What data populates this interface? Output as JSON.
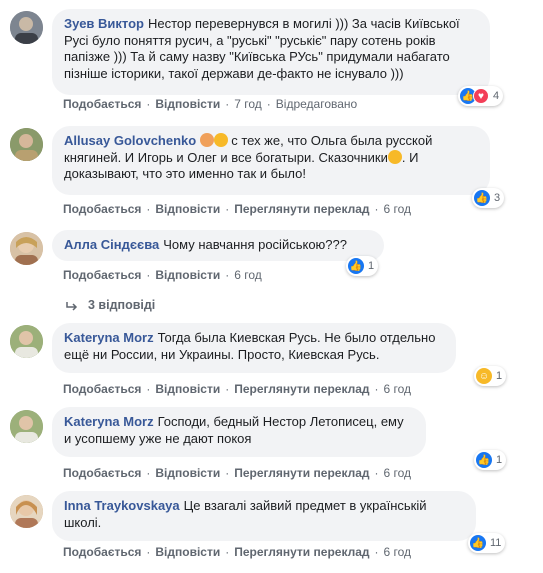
{
  "colors": {
    "author": "#385898",
    "bubble": "#f2f3f5",
    "meta": "#606770",
    "like": "#1877f2",
    "love": "#f33e58",
    "haha": "#f7b928"
  },
  "actions": {
    "like": "Подобається",
    "reply": "Відповісти",
    "translate": "Переглянути переклад",
    "edited": "Відредаговано"
  },
  "comments": [
    {
      "author": "Зуев Виктор",
      "text": "Нестор перевернувся в могилі ))) За часів Київської Русі було поняття русич, а \"руські\" \"руськіє\" пару сотень років папізже ))) Та й саму назву \"Київська РУсь\" придумали набагато пізніше історики, такої держави де-факто не існувало )))",
      "time": "7 год",
      "reactions": "4",
      "reaction_icons": [
        "like-icon",
        "love-icon"
      ]
    },
    {
      "author": "Allusay Golovchenko",
      "text_before": "с тех же, что Ольга была русской княгиней. И Игорь и Олег и все богатыри. Сказочники",
      "text_after": ". И доказывают, что это именно так и было!",
      "time": "6 год",
      "reactions": "3",
      "reaction_icons": [
        "like-icon"
      ]
    },
    {
      "author": "Алла Сіндєєва",
      "text": "Чому навчання російською???",
      "time": "6 год",
      "reactions": "1",
      "reaction_icons": [
        "like-icon"
      ]
    },
    {
      "author": "Kateryna Morz",
      "text": "Тогда была Киевская Русь. Не было отдельно ещё ни России, ни Украины. Просто, Киевская Русь.",
      "time": "6 год",
      "reactions": "1",
      "reaction_icons": [
        "haha-icon"
      ]
    },
    {
      "author": "Kateryna Morz",
      "text": "Господи, бедный Нестор Летописец, ему и усопшему уже не дают покоя",
      "time": "6 год",
      "reactions": "1",
      "reaction_icons": [
        "like-icon"
      ]
    },
    {
      "author": "Inna Traykovskaya",
      "text": "Це взагалі зайвий предмет в українській школі.",
      "time": "6 год",
      "reactions": "11",
      "reaction_icons": [
        "like-icon"
      ]
    }
  ],
  "replies_label": "3 відповіді"
}
